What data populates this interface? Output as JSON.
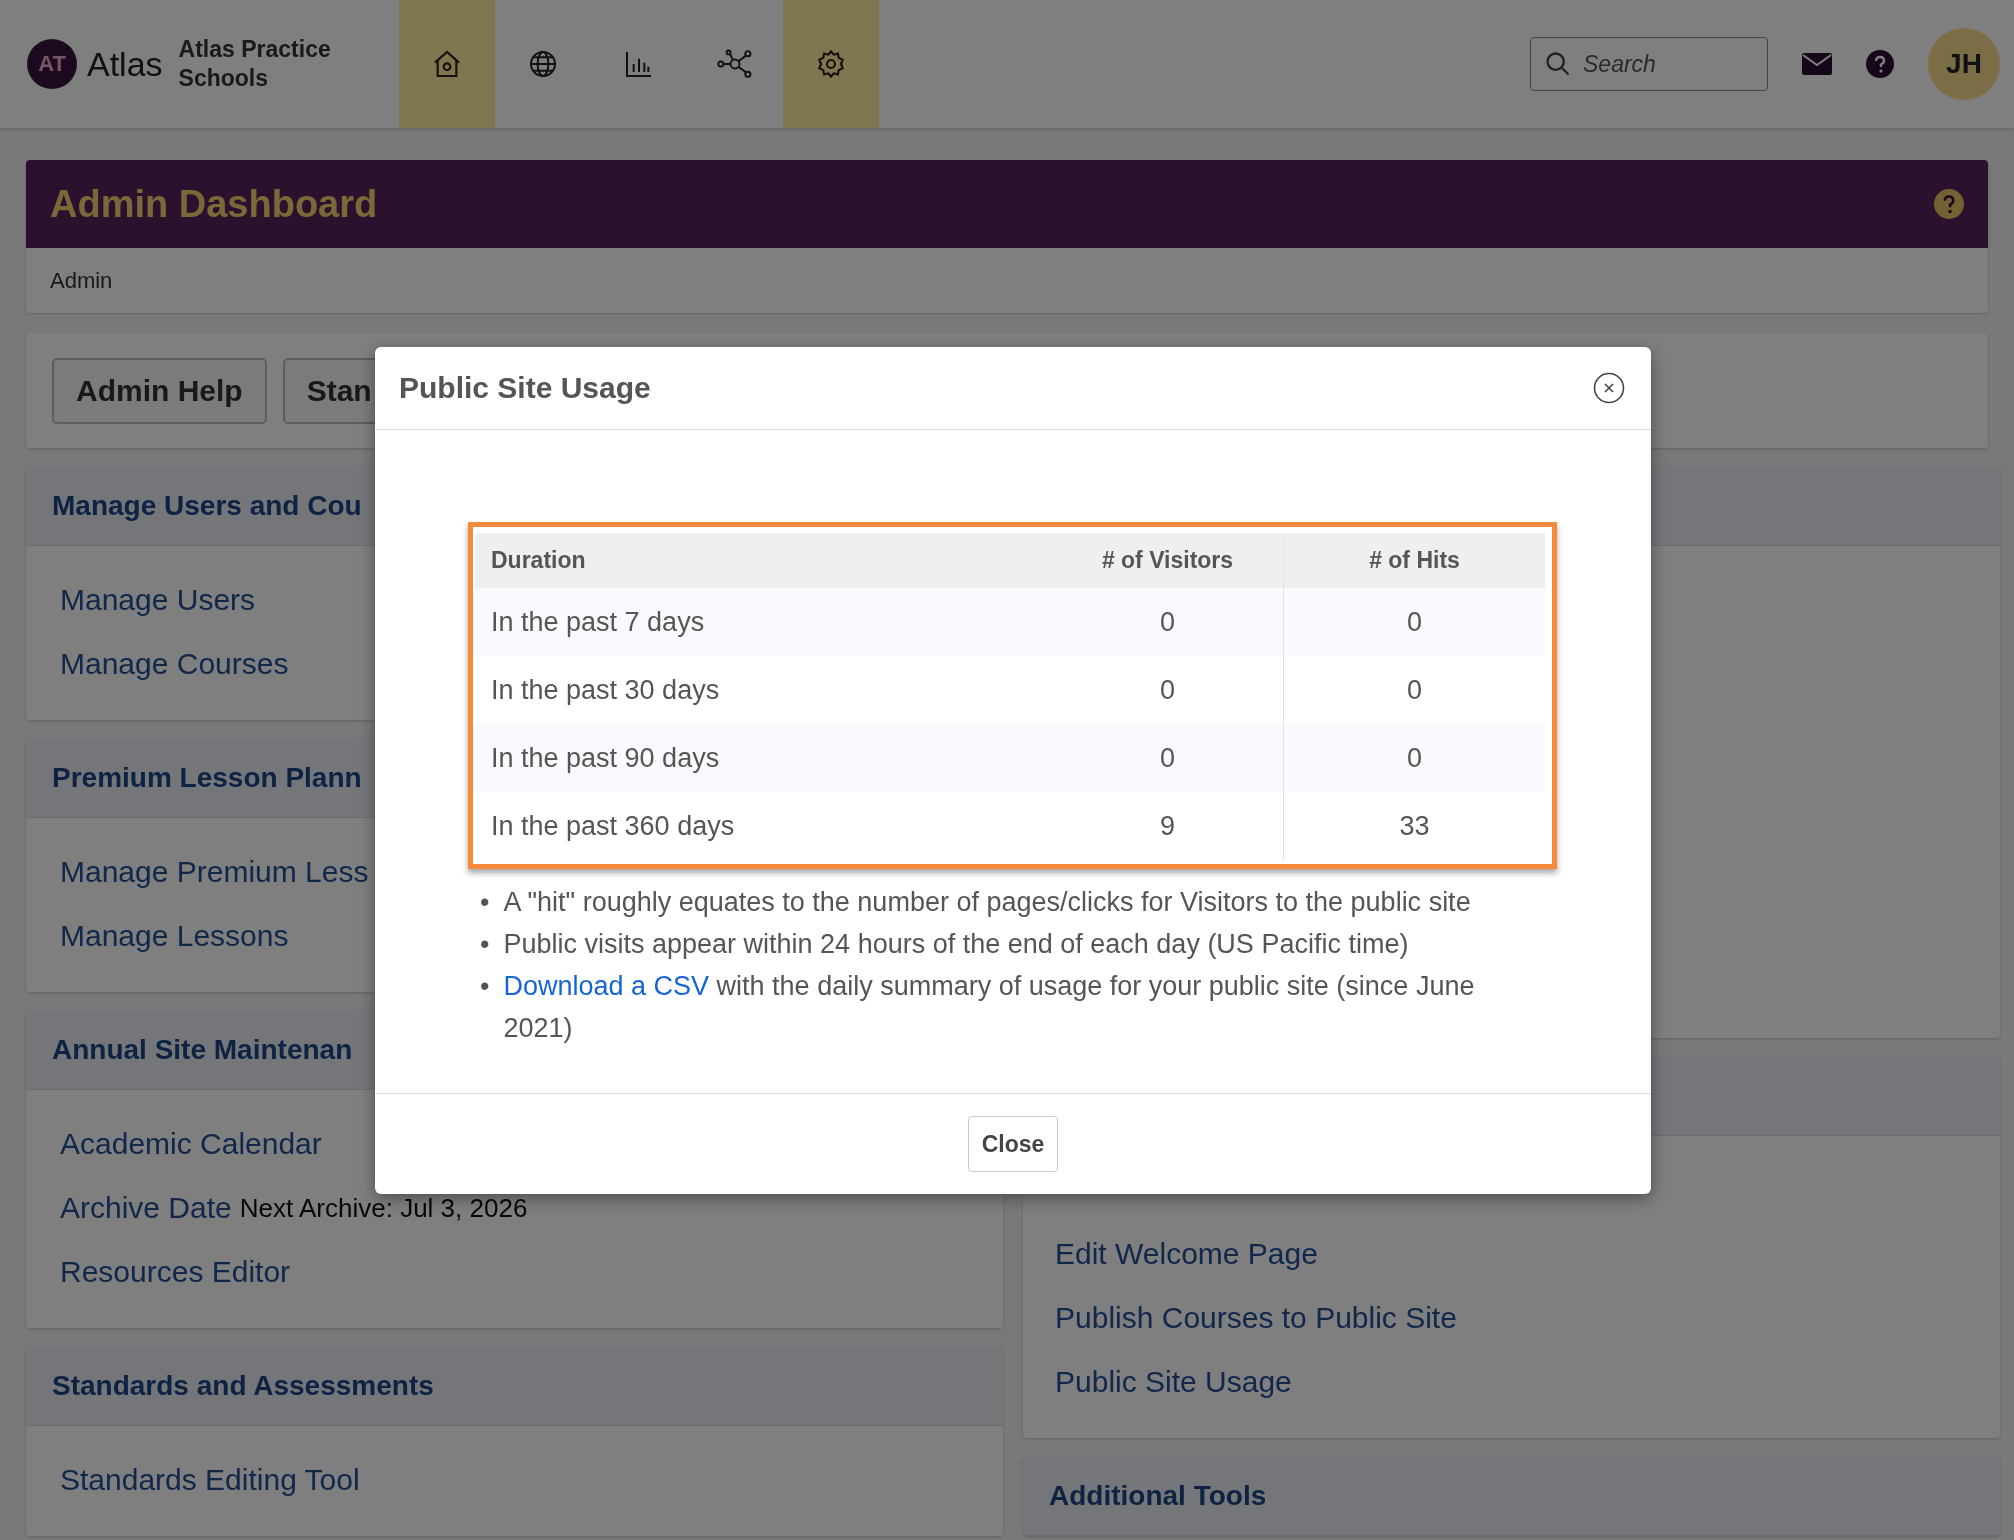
{
  "header": {
    "logo_initials": "AT",
    "brand": "Atlas",
    "org": "Atlas Practice Schools",
    "nav": [
      {
        "kind": "home",
        "selected": true
      },
      {
        "kind": "globe",
        "selected": false
      },
      {
        "kind": "chart",
        "selected": false
      },
      {
        "kind": "network",
        "selected": false
      },
      {
        "kind": "gear",
        "selected": true
      }
    ],
    "search": {
      "placeholder": "Search"
    },
    "avatar": "JH"
  },
  "page": {
    "title": "Admin Dashboard",
    "breadcrumb": "Admin",
    "buttons": [
      "Admin Help",
      "Stan"
    ]
  },
  "left_panels": [
    {
      "title": "Manage Users and Cou",
      "links": [
        {
          "text": "Manage Users"
        },
        {
          "text": "Manage Courses"
        }
      ]
    },
    {
      "title": "Premium Lesson Plann",
      "links": [
        {
          "text": "Manage Premium Less"
        },
        {
          "text": "Manage Lessons"
        }
      ]
    },
    {
      "title": "Annual Site Maintenan",
      "links": [
        {
          "text": "Academic Calendar"
        },
        {
          "text": "Archive Date",
          "note": "Next Archive: Jul 3, 2026"
        },
        {
          "text": "Resources Editor"
        }
      ]
    },
    {
      "title": "Standards and Assessments",
      "links": [
        {
          "text": "Standards Editing Tool"
        }
      ]
    }
  ],
  "right_panels": [
    {
      "links": [
        {
          "text": "Edit Welcome Page"
        },
        {
          "text": "Publish Courses to Public Site"
        },
        {
          "text": "Public Site Usage"
        }
      ]
    },
    {
      "title": "Additional Tools"
    }
  ],
  "modal": {
    "title": "Public Site Usage",
    "table": {
      "columns": [
        "Duration",
        "# of Visitors",
        "# of Hits"
      ],
      "rows": [
        [
          "In the past 7 days",
          "0",
          "0"
        ],
        [
          "In the past 30 days",
          "0",
          "0"
        ],
        [
          "In the past 90 days",
          "0",
          "0"
        ],
        [
          "In the past 360 days",
          "9",
          "33"
        ]
      ]
    },
    "notes": [
      {
        "marker": "•",
        "text": "A \"hit\" roughly equates to the number of pages/clicks for Visitors to the public site"
      },
      {
        "marker": "•",
        "text": "Public visits appear within 24 hours of the end of each day (US Pacific time)"
      },
      {
        "marker": "•",
        "link": "Download a CSV",
        "text": " with the daily summary of usage for your public site (since June 2021)"
      }
    ],
    "close_button": "Close"
  }
}
